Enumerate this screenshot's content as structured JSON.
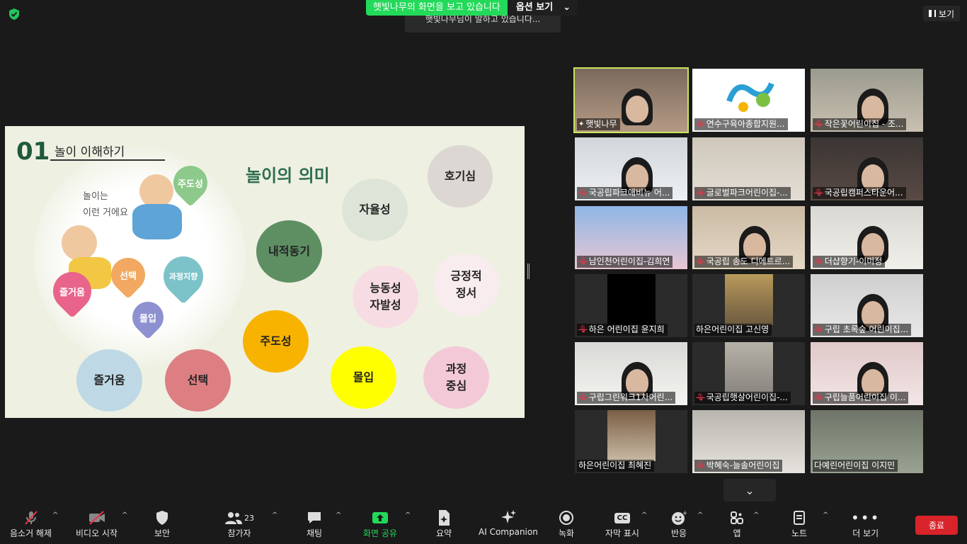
{
  "top": {
    "share_label": "햇빛나무의 화면을 보고 있습니다",
    "options_label": "옵션 보기",
    "toast": "햇빛나무님이 말하고 있습니다...",
    "view_label": "보기"
  },
  "slide": {
    "number": "01",
    "subtitle": "놀이 이해하기",
    "title": "놀이의 의미",
    "intro_line1": "놀이는",
    "intro_line2": "이런 거에요",
    "hearts": [
      "주도성",
      "선택",
      "과정지향",
      "즐거움",
      "몰입"
    ],
    "circles": [
      {
        "label": "호기심",
        "color": "#dcd7d3"
      },
      {
        "label": "자율성",
        "color": "#dde5d8"
      },
      {
        "label": "내적동기",
        "color": "#5e8f63"
      },
      {
        "label": "능동성\n자발성",
        "color": "#f7dde3"
      },
      {
        "label": "긍정적\n정서",
        "color": "#f8ecee"
      },
      {
        "label": "주도성",
        "color": "#f7b300"
      },
      {
        "label": "즐거움",
        "color": "#bed9e5"
      },
      {
        "label": "선택",
        "color": "#dd7e82"
      },
      {
        "label": "몰입",
        "color": "#ffff00"
      },
      {
        "label": "과정\n중심",
        "color": "#f3c9d8"
      }
    ]
  },
  "participants": [
    {
      "name": "햇빛나무",
      "muted": false,
      "active": true
    },
    {
      "name": "연수구육아종합지원...",
      "muted": true
    },
    {
      "name": "작은꽃어린이집 - 조...",
      "muted": true
    },
    {
      "name": "국공립파크애비뉴 어...",
      "muted": true
    },
    {
      "name": "글로벌파크어린이집-...",
      "muted": true
    },
    {
      "name": "국공립캠퍼스타운어...",
      "muted": true
    },
    {
      "name": "남인천어린이집-김희연",
      "muted": true
    },
    {
      "name": "국공립 송도 디에트르...",
      "muted": true
    },
    {
      "name": "더샵향기-이미정",
      "muted": true
    },
    {
      "name": "하은 어린이집 윤지희",
      "muted": true
    },
    {
      "name": "하은어린이집 고신영",
      "muted": false
    },
    {
      "name": "구립 초록숲 어린이집...",
      "muted": true
    },
    {
      "name": "구립그린워크1차어린...",
      "muted": true
    },
    {
      "name": "국공립햇살어린이집-...",
      "muted": true
    },
    {
      "name": "구립늘품어린이집 이...",
      "muted": true
    },
    {
      "name": "하은어린이집 최혜진",
      "muted": false
    },
    {
      "name": "박혜숙-늘솔어린이집",
      "muted": true
    },
    {
      "name": "다예린어린이집 이지민",
      "muted": false
    }
  ],
  "toolbar": {
    "mute": "음소거 해제",
    "video": "비디오 시작",
    "security": "보안",
    "participants": "참가자",
    "participant_count": "23",
    "chat": "채팅",
    "share": "화면 공유",
    "summary": "요약",
    "ai": "AI Companion",
    "record": "녹화",
    "captions": "자막 표시",
    "reactions": "반응",
    "apps": "앱",
    "notes": "노트",
    "more": "더 보기",
    "end": "종료"
  },
  "colors": {
    "accent_green": "#23d959",
    "active_border": "#c9e65a",
    "end_red": "#d8232a",
    "slide_bg": "#eef0e2"
  }
}
